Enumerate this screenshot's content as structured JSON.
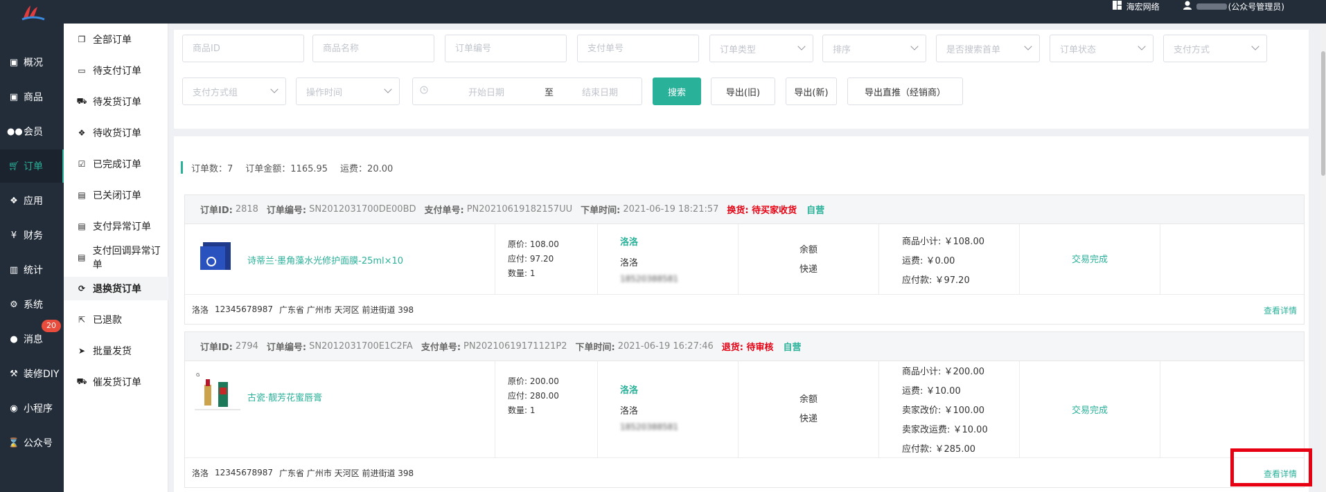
{
  "topbar": {
    "brand_label": "海宏网络",
    "user_suffix": "(公众号管理员)"
  },
  "leftnav": {
    "items": [
      {
        "label": "概况",
        "icon": "dashboard-icon"
      },
      {
        "label": "商品",
        "icon": "goods-icon"
      },
      {
        "label": "会员",
        "icon": "members-icon"
      },
      {
        "label": "订单",
        "icon": "cart-icon"
      },
      {
        "label": "应用",
        "icon": "apps-icon"
      },
      {
        "label": "财务",
        "icon": "yen-icon"
      },
      {
        "label": "统计",
        "icon": "stats-icon"
      },
      {
        "label": "系统",
        "icon": "gears-icon"
      },
      {
        "label": "消息",
        "icon": "message-icon"
      },
      {
        "label": "装修DIY",
        "icon": "hammer-icon"
      },
      {
        "label": "小程序",
        "icon": "wechat-icon"
      },
      {
        "label": "公众号",
        "icon": "hourglass-icon"
      }
    ],
    "message_badge": "20"
  },
  "subnav": {
    "items": [
      {
        "label": "全部订单"
      },
      {
        "label": "待支付订单"
      },
      {
        "label": "待发货订单"
      },
      {
        "label": "待收货订单"
      },
      {
        "label": "已完成订单"
      },
      {
        "label": "已关闭订单"
      },
      {
        "label": "支付异常订单"
      },
      {
        "label": "支付回调异常订单"
      },
      {
        "label": "退换货订单"
      },
      {
        "label": "已退款"
      },
      {
        "label": "批量发货"
      },
      {
        "label": "催发货订单"
      }
    ]
  },
  "filters": {
    "goods_id": "商品ID",
    "goods_name": "商品名称",
    "order_no": "订单编号",
    "pay_no": "支付单号",
    "order_type": "订单类型",
    "sort": "排序",
    "is_first": "是否搜索首单",
    "order_status": "订单状态",
    "pay_method": "支付方式",
    "pay_group": "支付方式组",
    "op_time": "操作时间",
    "start_date": "开始日期",
    "to": "至",
    "end_date": "结束日期",
    "search_btn": "搜索",
    "export_old_btn": "导出(旧)",
    "export_new_btn": "导出(新)",
    "export_direct_btn": "导出直推（经销商）"
  },
  "summary": {
    "order_count": "订单数：7",
    "order_amount": "订单金额：1165.95",
    "freight": "运费：20.00"
  },
  "orders": [
    {
      "id_label": "订单ID:",
      "id": "2818",
      "no_label": "订单编号:",
      "no": "SN2012031700DE00BD",
      "pay_label": "支付单号:",
      "pay": "PN20210619182157UU",
      "time_label": "下单时间:",
      "time": "2021-06-19 18:21:57",
      "status": "换货: 待买家收货",
      "self": "自营",
      "product": "诗蒂兰·墨角藻水光修护面膜-25ml×10",
      "price": "原价: 108.00",
      "payable": "应付: 97.20",
      "qty": "数量: 1",
      "buyer": "洛洛",
      "buyer2": "洛洛",
      "phone": "18520388581",
      "pay_type": "余额",
      "ship": "快递",
      "subtotal": "商品小计: ￥108.00",
      "fee": "运费: ￥0.00",
      "total": "应付款: ￥97.20",
      "state": "交易完成",
      "addr_name": "洛洛",
      "addr_phone": "12345678987",
      "addr": "广东省 广州市 天河区 前进街道 398",
      "detail": "查看详情"
    },
    {
      "id_label": "订单ID:",
      "id": "2794",
      "no_label": "订单编号:",
      "no": "SN2012031700E1C2FA",
      "pay_label": "支付单号:",
      "pay": "PN20210619171121P2",
      "time_label": "下单时间:",
      "time": "2021-06-19 16:27:46",
      "status": "退货: 待审核",
      "self": "自营",
      "product": "古瓷·靓芳花蜜唇膏",
      "price": "原价: 200.00",
      "payable": "应付: 280.00",
      "qty": "数量: 1",
      "buyer": "洛洛",
      "buyer2": "洛洛",
      "phone": "18520388581",
      "pay_type": "余额",
      "ship": "快递",
      "subtotal": "商品小计: ￥200.00",
      "fee": "运费: ￥10.00",
      "seller_price": "卖家改价: ￥100.00",
      "seller_fee": "卖家改运费: ￥10.00",
      "total": "应付款: ￥285.00",
      "state": "交易完成",
      "addr_name": "洛洛",
      "addr_phone": "12345678987",
      "addr": "广东省 广州市 天河区 前进街道 398",
      "detail": "查看详情"
    }
  ],
  "colors": {
    "accent": "#2ab19a",
    "sidebar": "#232d3a",
    "danger": "#e60012"
  }
}
